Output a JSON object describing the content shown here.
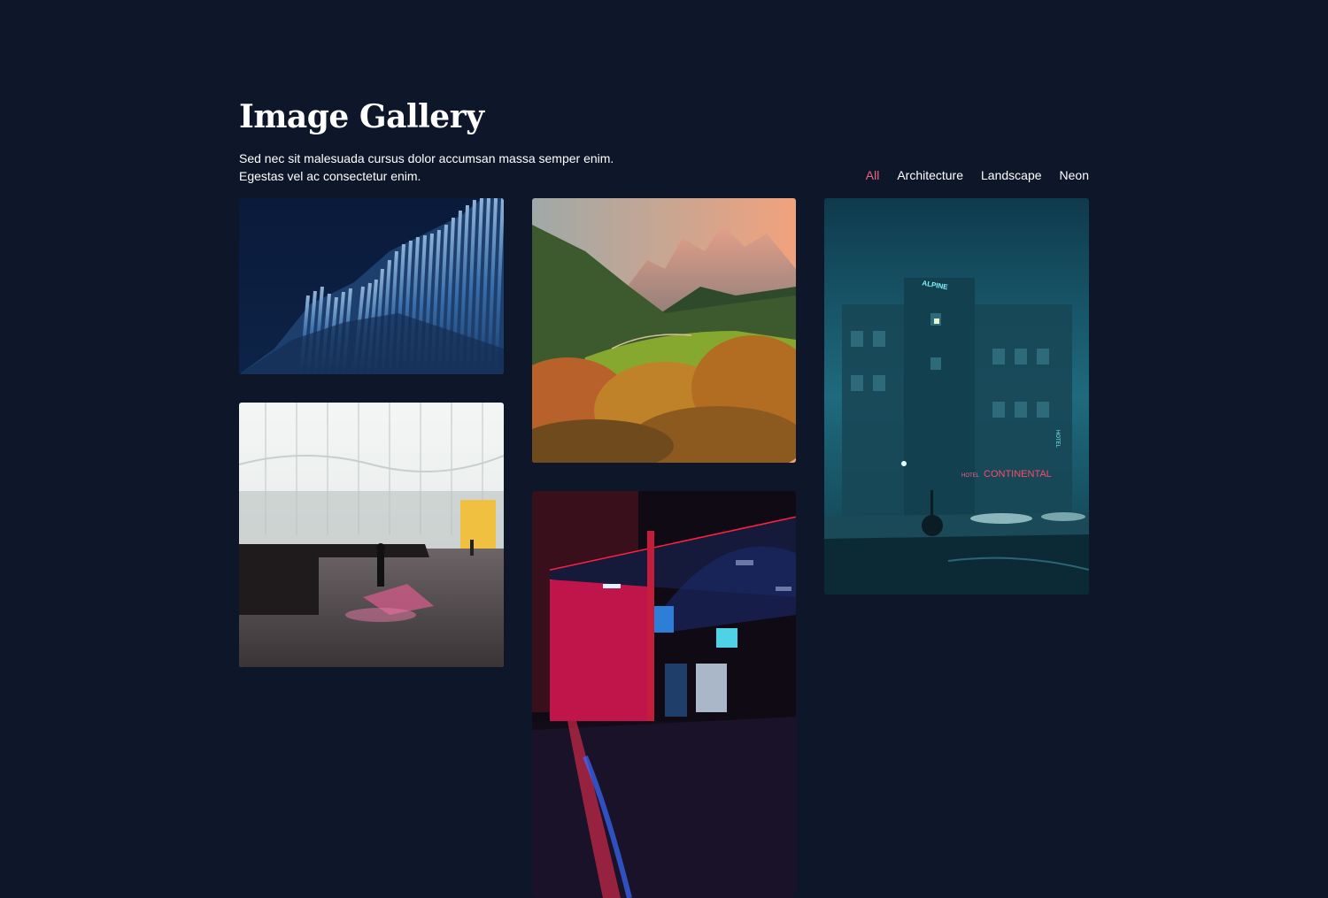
{
  "header": {
    "title": "Image Gallery",
    "subtitle": "Sed nec sit malesuada cursus dolor accumsan massa semper enim. Egestas vel ac consectetur enim."
  },
  "filters": [
    {
      "label": "All",
      "active": true
    },
    {
      "label": "Architecture",
      "active": false
    },
    {
      "label": "Landscape",
      "active": false
    },
    {
      "label": "Neon",
      "active": false
    }
  ],
  "colors": {
    "background": "#0e1629",
    "accent": "#f06680",
    "text": "#ffffff"
  },
  "gallery": [
    {
      "id": "img-1",
      "category": "Architecture",
      "subject": "wavy blue facade at night"
    },
    {
      "id": "img-2",
      "category": "Architecture",
      "subject": "bright glass interior with silhouettes"
    },
    {
      "id": "img-3",
      "category": "Landscape",
      "subject": "mountain valley in autumn"
    },
    {
      "id": "img-4",
      "category": "Neon",
      "subject": "red neon gas station at night"
    },
    {
      "id": "img-5",
      "category": "Neon",
      "subject": "foggy street with hotel neon sign"
    }
  ],
  "signs": {
    "hotel_top": "ALPINE",
    "continental": "CONTINENTAL",
    "hotel_small": "HOTEL",
    "hotel_vertical": "HOTEL"
  }
}
